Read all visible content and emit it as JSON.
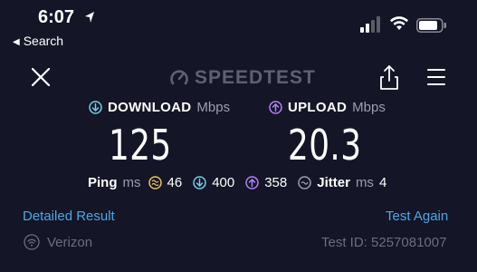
{
  "status_bar": {
    "time": "6:07",
    "back_label": "Search"
  },
  "header": {
    "logo_text": "SPEEDTEST"
  },
  "download": {
    "label": "DOWNLOAD",
    "unit": "Mbps",
    "value": "125",
    "color": "#6fd0e8"
  },
  "upload": {
    "label": "UPLOAD",
    "unit": "Mbps",
    "value": "20.3",
    "color": "#b084f5"
  },
  "ping": {
    "label": "Ping",
    "unit": "ms",
    "idle": "46",
    "download": "400",
    "upload": "358",
    "idle_color": "#e8c55a"
  },
  "jitter": {
    "label": "Jitter",
    "unit": "ms",
    "value": "4"
  },
  "links": {
    "detailed_result": "Detailed Result",
    "test_again": "Test Again"
  },
  "provider": {
    "name": "Verizon",
    "test_id": "Test ID: 5257081007"
  },
  "colors": {
    "background": "#141526",
    "link": "#4aa8e6",
    "muted": "#6b6e7e"
  }
}
